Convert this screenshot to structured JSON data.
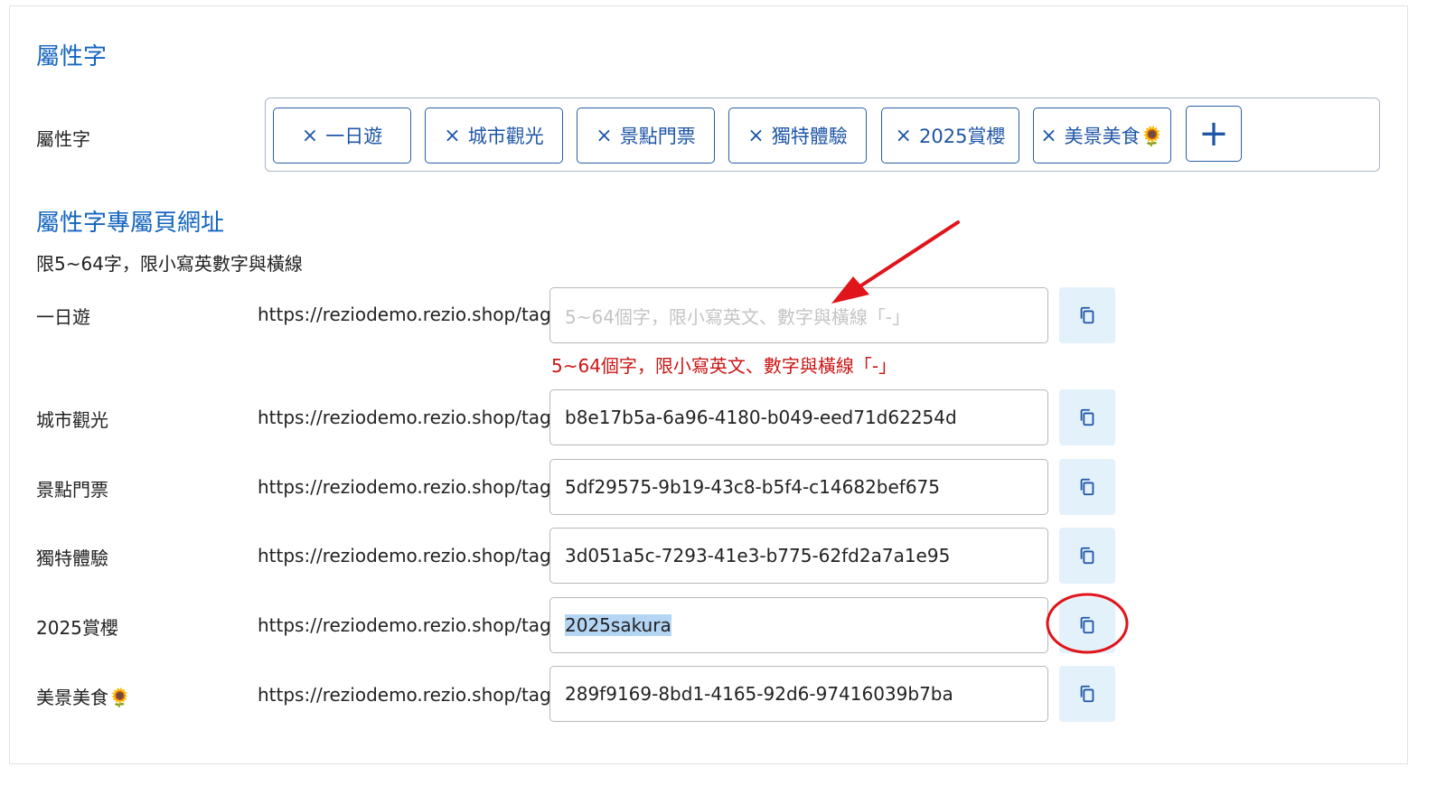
{
  "section1": {
    "title": "屬性字"
  },
  "tags_field": {
    "label": "屬性字",
    "chips": [
      {
        "label": "一日遊"
      },
      {
        "label": "城市觀光"
      },
      {
        "label": "景點門票"
      },
      {
        "label": "獨特體驗"
      },
      {
        "label": "2025賞櫻"
      },
      {
        "label": "美景美食🌻"
      }
    ],
    "remove_symbol": "×",
    "add_symbol": "+"
  },
  "section2": {
    "title": "屬性字專屬頁網址",
    "hint": "限5~64字，限小寫英數字與橫線"
  },
  "url_prefix": "https://reziodemo.rezio.shop/tag/",
  "rows": [
    {
      "label": "一日遊",
      "value": "",
      "placeholder": "5~64個字，限小寫英文、數字與橫線「-」",
      "error": "5~64個字，限小寫英文、數字與橫線「-」"
    },
    {
      "label": "城市觀光",
      "value": "b8e17b5a-6a96-4180-b049-eed71d62254d"
    },
    {
      "label": "景點門票",
      "value": "5df29575-9b19-43c8-b5f4-c14682bef675"
    },
    {
      "label": "獨特體驗",
      "value": "3d051a5c-7293-41e3-b775-62fd2a7a1e95"
    },
    {
      "label": "2025賞櫻",
      "value": "2025sakura",
      "selected": true
    },
    {
      "label": "美景美食🌻",
      "value": "289f9169-8bd1-4165-92d6-97416039b7ba"
    }
  ],
  "colors": {
    "accent": "#1565c0",
    "error": "#cc1414",
    "copy_button_bg": "#e3f1fb",
    "annotation": "#e0141b"
  },
  "icons": {
    "copy": "copy-icon",
    "remove": "close-icon",
    "add": "plus-icon"
  }
}
